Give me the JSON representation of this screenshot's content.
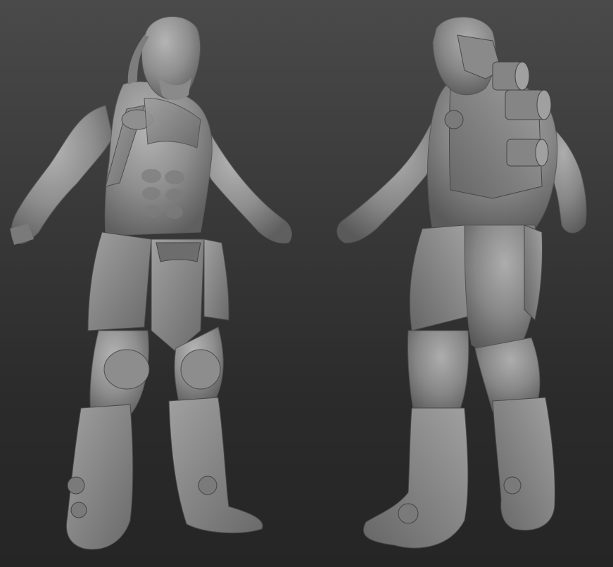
{
  "scene": {
    "subject": "sculpted-armored-character",
    "views": [
      {
        "view": "front-three-quarter"
      },
      {
        "view": "back-three-quarter"
      }
    ],
    "colors": {
      "background_top": "#4a4a4a",
      "background_bottom": "#252525",
      "clay_light": "#a9a9a9",
      "clay_mid": "#8a8a8a",
      "clay_dark": "#5e5e5e"
    }
  }
}
